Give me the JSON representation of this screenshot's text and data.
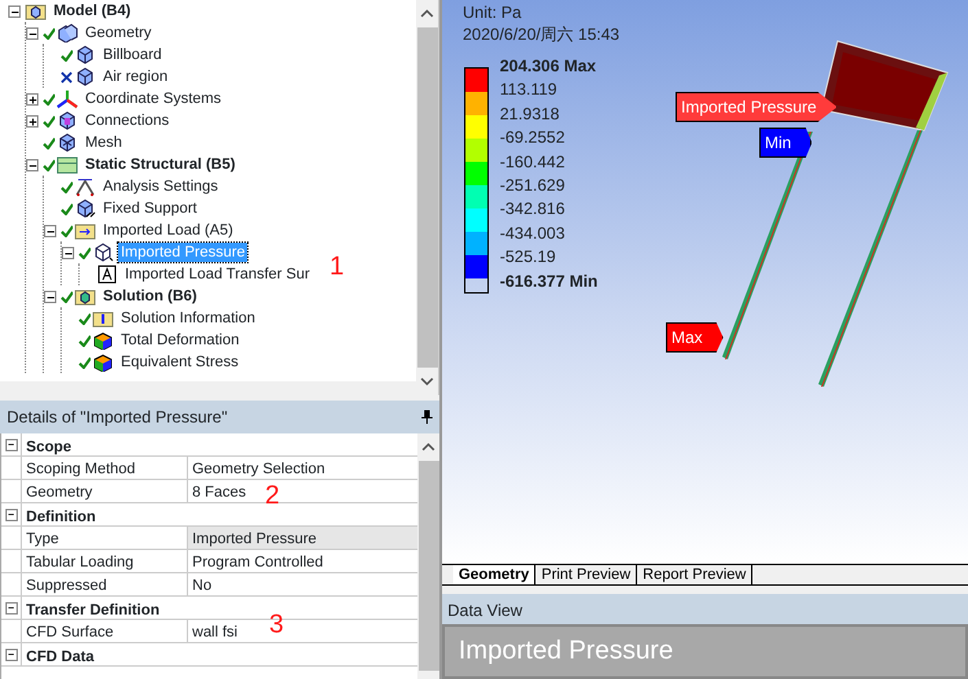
{
  "tree": [
    {
      "label": "Model (B4)",
      "bold": true,
      "kind": "model",
      "expanded": true,
      "selected": false,
      "children": [
        {
          "label": "Geometry",
          "kind": "geometry",
          "suppressed": false,
          "expanded": true,
          "selected": false,
          "children": [
            {
              "label": "Billboard",
              "kind": "body",
              "suppressed": false,
              "selected": false
            },
            {
              "label": "Air region",
              "kind": "body",
              "suppressed": true,
              "selected": false
            }
          ]
        },
        {
          "label": "Coordinate Systems",
          "kind": "axes",
          "suppressed": false,
          "expanded": false,
          "selected": false
        },
        {
          "label": "Connections",
          "kind": "connections",
          "suppressed": false,
          "expanded": false,
          "selected": false
        },
        {
          "label": "Mesh",
          "kind": "mesh",
          "suppressed": false,
          "selected": false
        },
        {
          "label": "Static Structural (B5)",
          "bold": true,
          "kind": "analysis",
          "suppressed": false,
          "expanded": true,
          "selected": false,
          "children": [
            {
              "label": "Analysis Settings",
              "kind": "settings",
              "suppressed": false,
              "selected": false
            },
            {
              "label": "Fixed Support",
              "kind": "support",
              "suppressed": false,
              "selected": false
            },
            {
              "label": "Imported Load (A5)",
              "kind": "load",
              "suppressed": false,
              "expanded": true,
              "selected": false,
              "children": [
                {
                  "label": "Imported Pressure",
                  "kind": "pressure",
                  "suppressed": false,
                  "expanded": true,
                  "selected": true,
                  "children": [
                    {
                      "label": "Imported Load Transfer Sur",
                      "kind": "text",
                      "selected": false
                    }
                  ]
                }
              ]
            },
            {
              "label": "Solution (B6)",
              "bold": true,
              "kind": "solution",
              "suppressed": false,
              "expanded": true,
              "selected": false,
              "children": [
                {
                  "label": "Solution Information",
                  "kind": "info",
                  "suppressed": false,
                  "selected": false
                },
                {
                  "label": "Total Deformation",
                  "kind": "result",
                  "suppressed": false,
                  "selected": false
                },
                {
                  "label": "Equivalent Stress",
                  "kind": "result",
                  "suppressed": false,
                  "selected": false
                }
              ]
            }
          ]
        }
      ]
    }
  ],
  "details": {
    "title": "Details of \"Imported Pressure\"",
    "sections": [
      {
        "name": "Scope",
        "expanded": true,
        "rows": [
          {
            "label": "Scoping Method",
            "value": "Geometry Selection",
            "selected": false
          },
          {
            "label": "Geometry",
            "value": "8 Faces",
            "selected": false
          }
        ]
      },
      {
        "name": "Definition",
        "expanded": true,
        "rows": [
          {
            "label": "Type",
            "value": "Imported Pressure",
            "selected": true
          },
          {
            "label": "Tabular Loading",
            "value": "Program Controlled",
            "selected": false
          },
          {
            "label": "Suppressed",
            "value": "No",
            "selected": false
          }
        ]
      },
      {
        "name": "Transfer Definition",
        "expanded": true,
        "rows": [
          {
            "label": "CFD Surface",
            "value": "wall fsi",
            "selected": false
          }
        ]
      },
      {
        "name": "CFD Data",
        "expanded": true
      }
    ]
  },
  "annotations": [
    {
      "text": "1"
    },
    {
      "text": "2"
    },
    {
      "text": "3"
    }
  ],
  "viewport": {
    "unit": "Unit: Pa",
    "timestamp": "2020/6/20/周六 15:43",
    "legend": [
      {
        "label": "204.306 Max",
        "bold": true,
        "color": "#ff0000"
      },
      {
        "label": "113.119",
        "color": "#ffb200"
      },
      {
        "label": "21.9318",
        "color": "#ffff00"
      },
      {
        "label": "-69.2552",
        "color": "#b2ff00"
      },
      {
        "label": "-160.442",
        "color": "#00ff00"
      },
      {
        "label": "-251.629",
        "color": "#00ffb2"
      },
      {
        "label": "-342.816",
        "color": "#00ffff"
      },
      {
        "label": "-434.003",
        "color": "#00b2ff"
      },
      {
        "label": "-525.19",
        "color": "#0000ff"
      },
      {
        "label": "-616.377 Min",
        "bold": true
      }
    ],
    "callouts": [
      {
        "text": "Imported Pressure",
        "color": "#ff3b3b"
      },
      {
        "text": "Min",
        "color": "#0000ff"
      },
      {
        "text": "Max",
        "color": "#ff0000"
      }
    ]
  },
  "tabs": [
    {
      "label": "Geometry",
      "selected": true
    },
    {
      "label": "Print Preview",
      "selected": false
    },
    {
      "label": "Report Preview",
      "selected": false
    }
  ],
  "data_view": {
    "header": "Data View",
    "title": "Imported Pressure"
  }
}
